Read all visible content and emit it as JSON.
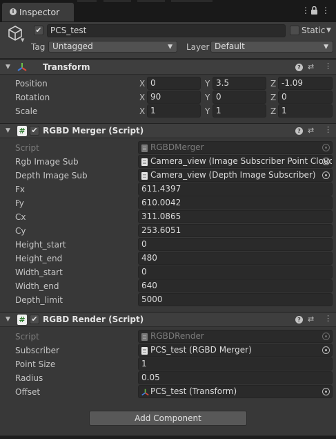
{
  "tab": {
    "title": "Inspector"
  },
  "gameobject": {
    "name": "PCS_test",
    "static_label": "Static",
    "tag_label": "Tag",
    "tag_value": "Untagged",
    "layer_label": "Layer",
    "layer_value": "Default"
  },
  "transform": {
    "title": "Transform",
    "rows": [
      {
        "label": "Position",
        "x": "0",
        "y": "3.5",
        "z": "-1.09"
      },
      {
        "label": "Rotation",
        "x": "90",
        "y": "0",
        "z": "0"
      },
      {
        "label": "Scale",
        "x": "1",
        "y": "1",
        "z": "1"
      }
    ],
    "axis_x": "X",
    "axis_y": "Y",
    "axis_z": "Z"
  },
  "merger": {
    "title": "RGBD Merger (Script)",
    "script_label": "Script",
    "script_value": "RGBDMerger",
    "rgb_label": "Rgb Image Sub",
    "rgb_value": "Camera_view (Image Subscriber Point Clouc",
    "depth_label": "Depth Image Sub",
    "depth_value": "Camera_view (Depth Image Subscriber)",
    "fields": [
      {
        "label": "Fx",
        "value": "611.4397"
      },
      {
        "label": "Fy",
        "value": "610.0042"
      },
      {
        "label": "Cx",
        "value": "311.0865"
      },
      {
        "label": "Cy",
        "value": "253.6051"
      },
      {
        "label": "Height_start",
        "value": "0"
      },
      {
        "label": "Height_end",
        "value": "480"
      },
      {
        "label": "Width_start",
        "value": "0"
      },
      {
        "label": "Width_end",
        "value": "640"
      },
      {
        "label": "Depth_limit",
        "value": "5000"
      }
    ]
  },
  "render": {
    "title": "RGBD Render (Script)",
    "script_label": "Script",
    "script_value": "RGBDRender",
    "subscriber_label": "Subscriber",
    "subscriber_value": "PCS_test (RGBD Merger)",
    "point_size_label": "Point Size",
    "point_size_value": "1",
    "radius_label": "Radius",
    "radius_value": "0.05",
    "offset_label": "Offset",
    "offset_value": "PCS_test (Transform)"
  },
  "add_component": "Add Component",
  "icons": [
    "info-icon",
    "lock-icon",
    "menu-icon",
    "cube-icon",
    "transform-icon",
    "help-icon",
    "preset-icon",
    "kebab-icon",
    "script-icon",
    "object-picker-icon"
  ],
  "colors": {
    "background": "#383838",
    "header": "#3e3e3e",
    "field": "#2a2a2a",
    "button": "#585858"
  }
}
